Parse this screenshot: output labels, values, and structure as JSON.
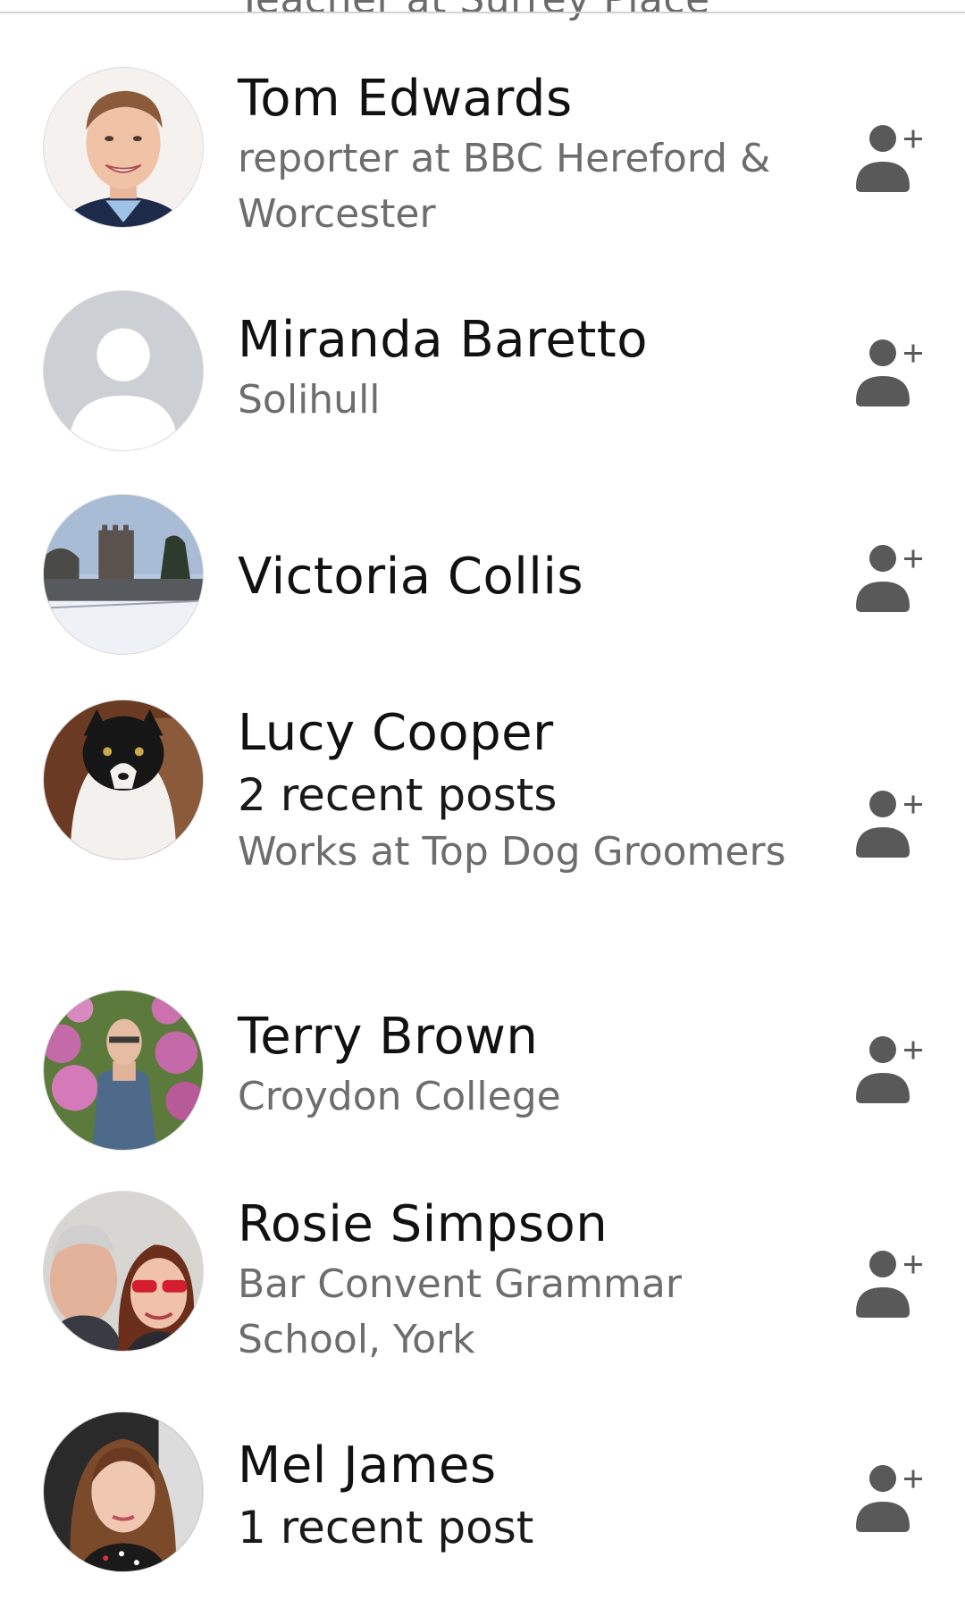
{
  "header": {
    "cutoff_text": "Teacher at Surrey Place"
  },
  "colors": {
    "name_text": "#111111",
    "secondary_text": "#6d6d6d",
    "add_friend_icon": "#595959",
    "placeholder_avatar_bg": "#ccd0d5"
  },
  "people": [
    {
      "name": "Tom Edwards",
      "subtitle": "reporter at BBC Hereford & Worcester",
      "avatar": "photo",
      "action_icon": "add-friend-icon"
    },
    {
      "name": "Miranda Baretto",
      "subtitle": "Solihull",
      "avatar": "default-placeholder",
      "action_icon": "add-friend-icon"
    },
    {
      "name": "Victoria Collis",
      "avatar": "photo",
      "action_icon": "add-friend-icon"
    },
    {
      "name": "Lucy Cooper",
      "recent_posts": "2 recent posts",
      "subtitle": "Works at Top Dog Groomers",
      "avatar": "photo",
      "action_icon": "add-friend-icon"
    },
    {
      "name": "Terry Brown",
      "subtitle": "Croydon College",
      "avatar": "photo",
      "action_icon": "add-friend-icon"
    },
    {
      "name": "Rosie Simpson",
      "subtitle": "Bar Convent Grammar School, York",
      "avatar": "photo",
      "action_icon": "add-friend-icon"
    },
    {
      "name": "Mel James",
      "recent_posts": "1 recent post",
      "avatar": "photo",
      "action_icon": "add-friend-icon"
    }
  ]
}
